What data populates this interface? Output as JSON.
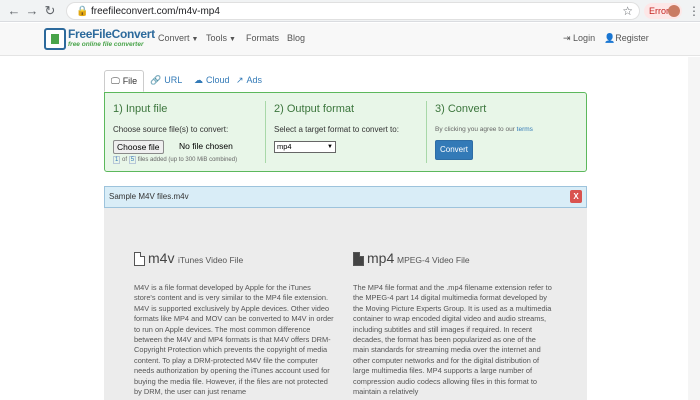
{
  "browser": {
    "back_icon": "back-arrow-icon",
    "forward_icon": "forward-arrow-icon",
    "reload_icon": "reload-icon",
    "url": "freefileconvert.com/m4v-mp4",
    "error_label": "Error"
  },
  "site": {
    "logo_title": "FreeFileConvert",
    "logo_tagline": "free online file converter",
    "nav": [
      {
        "label": "Convert",
        "dropdown": true
      },
      {
        "label": "Tools",
        "dropdown": true
      },
      {
        "label": "Formats",
        "dropdown": false
      },
      {
        "label": "Blog",
        "dropdown": false
      }
    ],
    "login": "Login",
    "register": "Register"
  },
  "tabs": [
    {
      "label": "File",
      "icon": "monitor-icon",
      "active": true
    },
    {
      "label": "URL",
      "icon": "link-icon",
      "active": false
    },
    {
      "label": "Cloud",
      "icon": "cloud-icon",
      "active": false
    },
    {
      "label": "Ads",
      "icon": "external-link-icon",
      "active": false
    }
  ],
  "converter": {
    "input": {
      "title": "1) Input file",
      "subtitle": "Choose source file(s) to convert:",
      "choose_button": "Choose file",
      "no_file": "No file chosen",
      "count_current": "1",
      "count_of": "of",
      "count_total": "5",
      "count_suffix": "files added (up to 300 MiB combined)"
    },
    "output": {
      "title": "2) Output format",
      "subtitle": "Select a target format to convert to:",
      "selected_format": "mp4"
    },
    "convert": {
      "title": "3) Convert",
      "agree_text": "By clicking you agree to our",
      "terms_link": "terms",
      "button": "Convert"
    }
  },
  "file_bar": {
    "filename": "Sample M4V files.m4v",
    "close": "X"
  },
  "formats": [
    {
      "ext": "m4v",
      "description": "iTunes Video File",
      "text": "M4V is a file format developed by Apple for the iTunes store's content and is very similar to the MP4 file extension. M4V is supported exclusively by Apple devices. Other video formats like MP4 and MOV can be converted to M4V in order to run on Apple devices. The most common difference between the M4V and MP4 formats is that M4V offers DRM-Copyright Protection which prevents the copyright of media content. To play a DRM-protected M4V file the computer needs authorization by opening the iTunes account used for buying the media file. However, if the files are not protected by DRM, the user can just rename"
    },
    {
      "ext": "mp4",
      "description": "MPEG-4 Video File",
      "text": "The MP4 file format and the .mp4 filename extension refer to the MPEG-4 part 14 digital multimedia format developed by the Moving Picture Experts Group. It is used as a multimedia container to wrap encoded digital video and audio streams, including subtitles and still images if required. In recent decades, the format has been popularized as one of the main standards for streaming media over the internet and other computer networks and for the digital distribution of large multimedia files. MP4 supports a large number of compression audio codecs allowing files in this format to maintain a relatively"
    }
  ],
  "colors": {
    "brand_blue": "#2d6a9c",
    "brand_green": "#49a44a",
    "panel_green": "#e8f6e8",
    "button_blue": "#337ab7",
    "close_red": "#d9534f"
  }
}
